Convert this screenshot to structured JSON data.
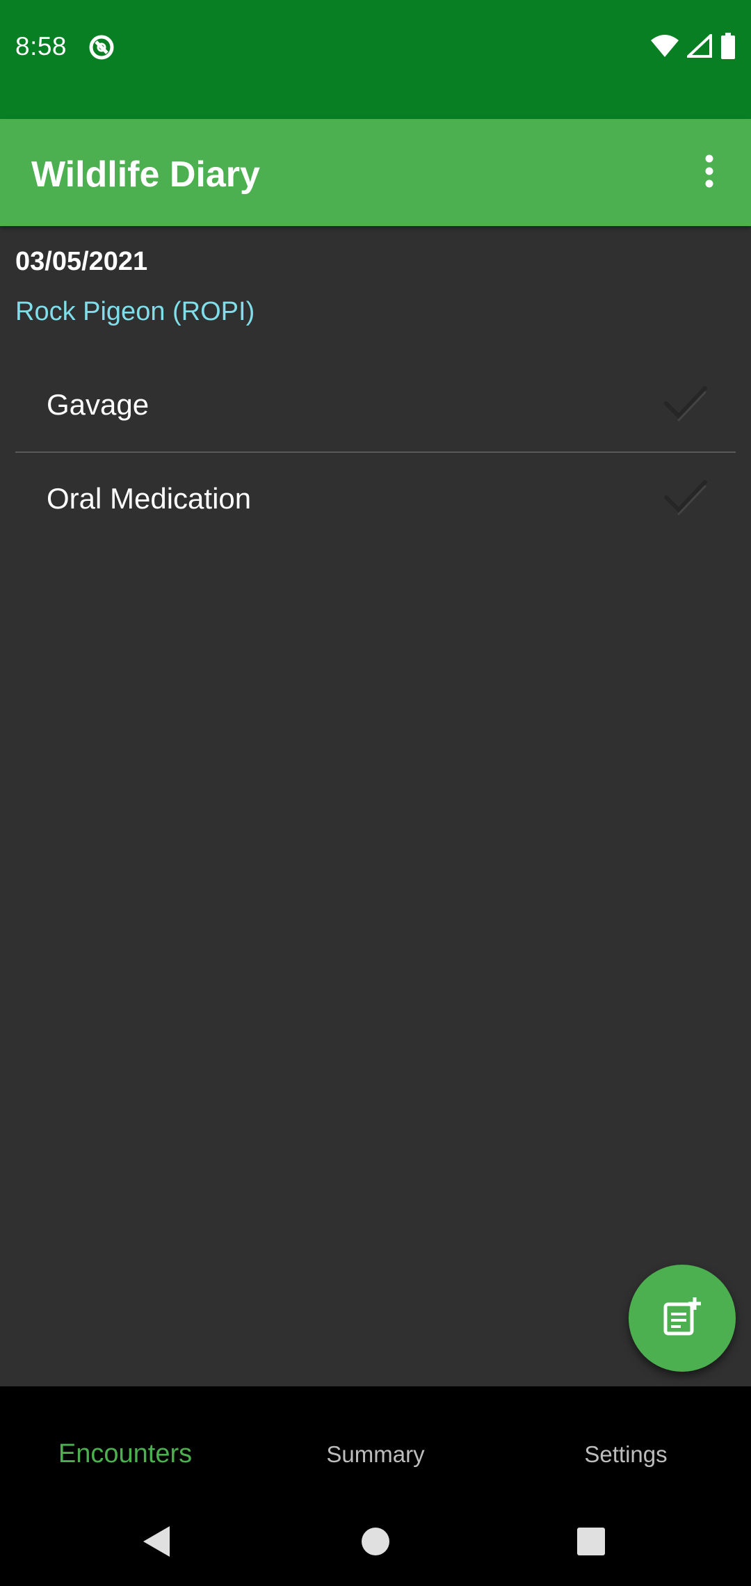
{
  "status_bar": {
    "time": "8:58",
    "icons": [
      "app-notification-icon",
      "wifi-icon",
      "signal-icon",
      "battery-icon"
    ]
  },
  "app_bar": {
    "title": "Wildlife Diary",
    "overflow_icon": "more-vert-icon"
  },
  "encounter": {
    "date": "03/05/2021",
    "species": "Rock Pigeon (ROPI)",
    "treatments": [
      {
        "label": "Gavage",
        "done": false
      },
      {
        "label": "Oral Medication",
        "done": false
      }
    ]
  },
  "fab": {
    "icon": "add-note-icon"
  },
  "bottom_nav": {
    "items": [
      {
        "label": "Encounters",
        "active": true
      },
      {
        "label": "Summary",
        "active": false
      },
      {
        "label": "Settings",
        "active": false
      }
    ]
  },
  "system_nav": {
    "icons": [
      "back-icon",
      "home-icon",
      "recents-icon"
    ]
  },
  "colors": {
    "status_bar": "#087f23",
    "app_bar": "#4caf50",
    "background": "#303030",
    "species_text": "#80deea",
    "accent": "#4caf50"
  }
}
